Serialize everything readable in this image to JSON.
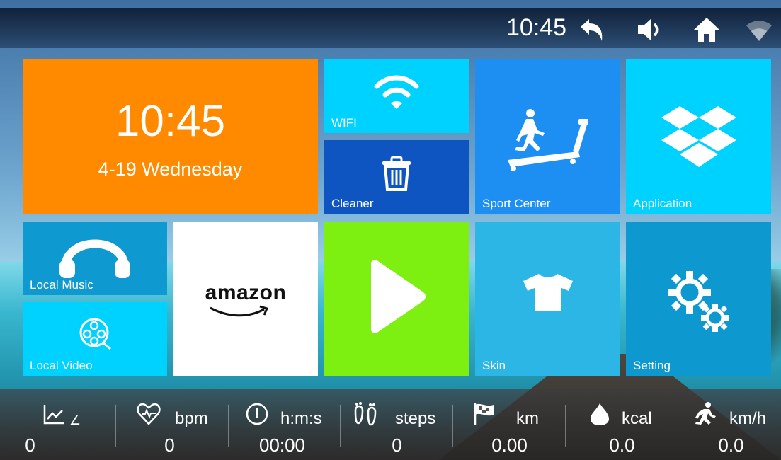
{
  "status_bar": {
    "time": "10:45",
    "icons": [
      "back-arrow-icon",
      "volume-icon",
      "home-icon",
      "wifi-signal-icon"
    ]
  },
  "tiles": {
    "clock": {
      "time": "10:45",
      "date": "4-19 Wednesday",
      "color": "#ff8a00"
    },
    "wifi": {
      "label": "WIFI",
      "icon": "wifi-icon",
      "color": "#00d2ff"
    },
    "cleaner": {
      "label": "Cleaner",
      "icon": "trash-icon",
      "color": "#0e55c2"
    },
    "sport_center": {
      "label": "Sport Center",
      "icon": "treadmill-runner-icon",
      "color": "#1d8ff2"
    },
    "application": {
      "label": "Application",
      "icon": "dropbox-icon",
      "color": "#00d2ff"
    },
    "local_music": {
      "label": "Local Music",
      "icon": "headphones-icon",
      "color": "#0e99d0"
    },
    "local_video": {
      "label": "Local Video",
      "icon": "film-reel-icon",
      "color": "#00d2ff"
    },
    "amazon": {
      "logo_text": "amazon",
      "icon": "amazon-logo",
      "color": "#ffffff"
    },
    "play": {
      "icon": "play-icon",
      "color": "#7df011"
    },
    "skin": {
      "label": "Skin",
      "icon": "tshirt-icon",
      "color": "#2bb6e6"
    },
    "setting": {
      "label": "Setting",
      "icon": "gears-icon",
      "color": "#0d99cf"
    }
  },
  "stats": [
    {
      "icon": "incline-icon",
      "unit": "∠",
      "value": "0"
    },
    {
      "icon": "heart-rate-icon",
      "unit": "bpm",
      "value": "0"
    },
    {
      "icon": "timer-icon",
      "unit": "h:m:s",
      "value": "00:00"
    },
    {
      "icon": "footsteps-icon",
      "unit": "steps",
      "value": "0"
    },
    {
      "icon": "finish-flag-icon",
      "unit": "km",
      "value": "0.00"
    },
    {
      "icon": "flame-icon",
      "unit": "kcal",
      "value": "0.0"
    },
    {
      "icon": "runner-speed-icon",
      "unit": "km/h",
      "value": "0.0"
    }
  ]
}
